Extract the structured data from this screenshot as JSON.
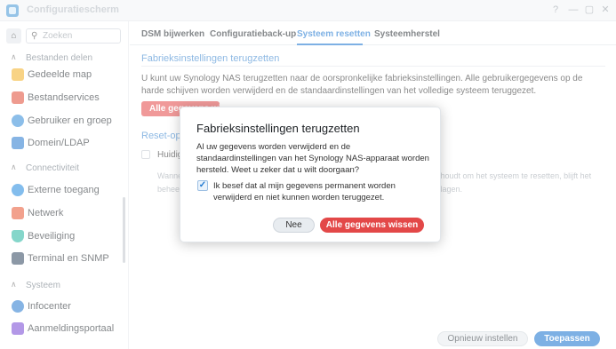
{
  "window": {
    "title": "Configuratiescherm",
    "controls": [
      "?",
      "—",
      "▢",
      "✕"
    ]
  },
  "sidebar": {
    "search_placeholder": "Zoeken",
    "sections": [
      {
        "title": "Bestanden delen",
        "items": [
          {
            "label": "Gedeelde map",
            "icon": "folder-icon",
            "color": "#f3b32e"
          },
          {
            "label": "Bestandservices",
            "icon": "file-services-icon",
            "color": "#e2533e"
          }
        ]
      },
      {
        "title": "",
        "items": [
          {
            "label": "Gebruiker en groep",
            "icon": "users-icon",
            "color": "#3a8fd9"
          },
          {
            "label": "Domein/LDAP",
            "icon": "domain-icon",
            "color": "#2f7fd1"
          }
        ]
      },
      {
        "title": "Connectiviteit",
        "items": [
          {
            "label": "Externe toegang",
            "icon": "globe-icon",
            "color": "#2a8de0"
          },
          {
            "label": "Netwerk",
            "icon": "network-house-icon",
            "color": "#e85d3b"
          },
          {
            "label": "Beveiliging",
            "icon": "shield-icon",
            "color": "#2db8a4"
          },
          {
            "label": "Terminal en SNMP",
            "icon": "terminal-icon",
            "color": "#3a4e66"
          }
        ]
      },
      {
        "title": "Systeem",
        "items": [
          {
            "label": "Infocenter",
            "icon": "info-icon",
            "color": "#2f7fd1"
          },
          {
            "label": "Aanmeldingsportaal",
            "icon": "portal-icon",
            "color": "#7d4fd6"
          }
        ]
      }
    ]
  },
  "tabs": [
    {
      "label": "DSM bijwerken",
      "active": false
    },
    {
      "label": "Configuratieback-up",
      "active": false
    },
    {
      "label": "Systeem resetten",
      "active": true
    },
    {
      "label": "Systeemherstel",
      "active": false
    }
  ],
  "content": {
    "factory_title": "Fabrieksinstellingen terugzetten",
    "factory_desc": "U kunt uw Synology NAS terugzetten naar de oorspronkelijke fabrieksinstellingen. Alle gebruikergegevens op de harde schijven worden verwijderd en de standaardinstellingen van het volledige systeem teruggezet.",
    "wipe_button_bg": "Alle gegevens wissen",
    "reset_title": "Reset-opties",
    "reset_checkbox_label": "Huidig",
    "warning_left_1": "Wanne",
    "warning_left_2": "behee",
    "warning_right_1": "kt houdt om het systeem te resetten, blijft het",
    "warning_right_2": "eslagen."
  },
  "footer": {
    "reset_label": "Opnieuw instellen",
    "apply_label": "Toepassen"
  },
  "dialog": {
    "title": "Fabrieksinstellingen terugzetten",
    "message": "Al uw gegevens worden verwijderd en de standaardinstellingen van het Synology NAS-apparaat worden hersteld. Weet u zeker dat u wilt doorgaan?",
    "confirm_label": "Ik besef dat al mijn gegevens permanent worden verwijderd en niet kunnen worden teruggezet.",
    "confirm_checked": true,
    "cancel_label": "Nee",
    "confirm_button_label": "Alle gegevens wissen"
  },
  "colors": {
    "accent": "#1f78d1",
    "danger": "#e34848"
  }
}
